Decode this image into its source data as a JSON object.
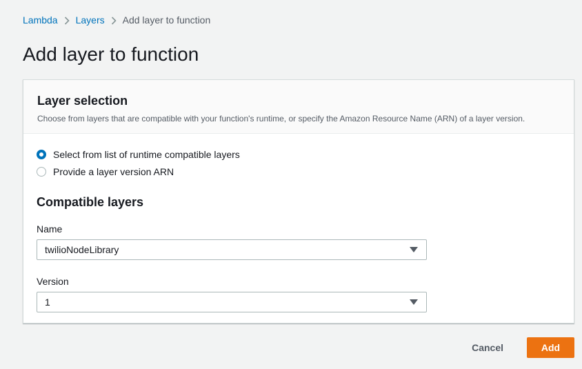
{
  "breadcrumb": {
    "items": [
      {
        "label": "Lambda"
      },
      {
        "label": "Layers"
      },
      {
        "label": "Add layer to function"
      }
    ]
  },
  "page": {
    "title": "Add layer to function"
  },
  "layer_selection": {
    "title": "Layer selection",
    "description": "Choose from layers that are compatible with your function's runtime, or specify the Amazon Resource Name (ARN) of a layer version.",
    "options": [
      {
        "label": "Select from list of runtime compatible layers",
        "selected": true
      },
      {
        "label": "Provide a layer version ARN",
        "selected": false
      }
    ]
  },
  "compatible_layers": {
    "title": "Compatible layers",
    "name_label": "Name",
    "name_value": "twilioNodeLibrary",
    "version_label": "Version",
    "version_value": "1"
  },
  "actions": {
    "cancel_label": "Cancel",
    "add_label": "Add"
  },
  "colors": {
    "link": "#0073bb",
    "primary_button": "#ec7211",
    "radio_selected": "#0073bb"
  }
}
